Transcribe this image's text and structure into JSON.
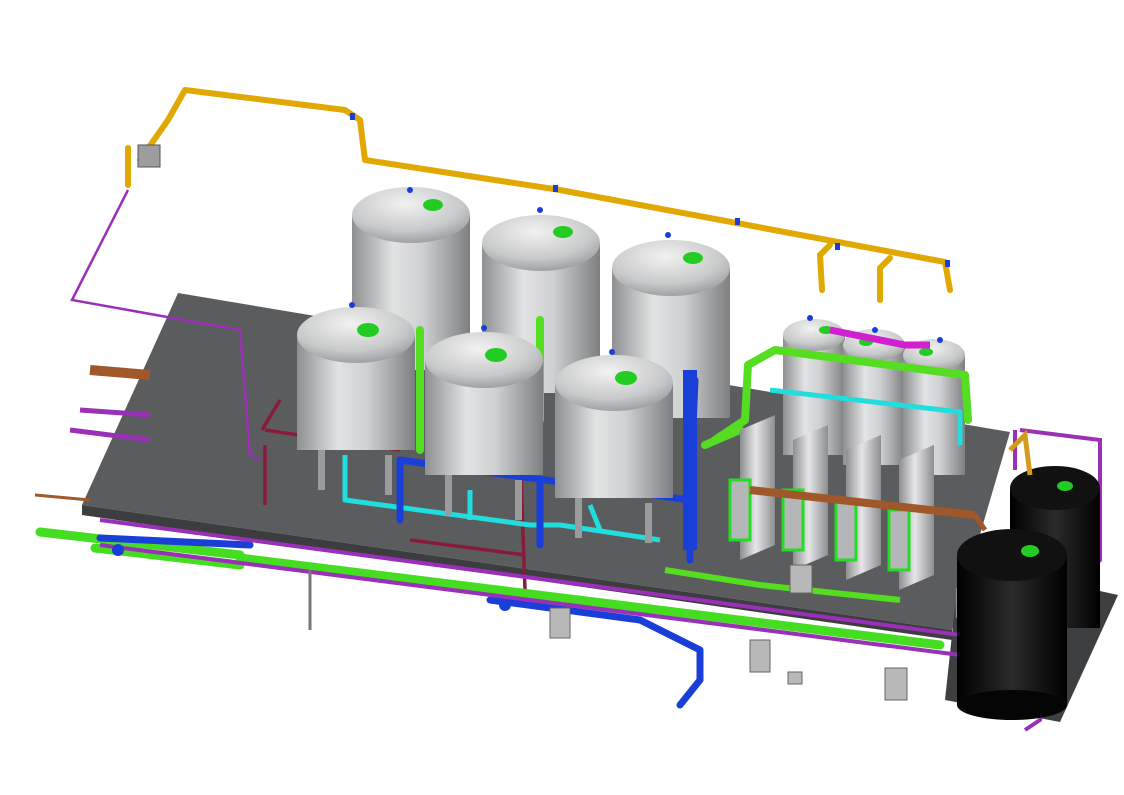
{
  "scene": {
    "kind": "3D piping and vessel layout rendering",
    "background": "#ffffff"
  },
  "colors": {
    "skid": "#58595b",
    "skid_top": "#666769",
    "vessel": "#c9cacb",
    "vessel_dark": "#8f9091",
    "nozzle_cap": "#22cc22",
    "air_line": "#e0a800",
    "green_line": "#55dd22",
    "cyan_line": "#22dddd",
    "blue_line": "#1a3fd8",
    "purple_line": "#9a2fb8",
    "maroon_line": "#8a1a3a",
    "copper_line": "#a0582a",
    "magenta_line": "#d020d0",
    "tank_black": "#0e0e0e",
    "panel_grey": "#b8b8b8"
  },
  "components": {
    "large_filter_vessels": 6,
    "small_vessels": 3,
    "membrane_modules": 4,
    "black_tanks": 2
  }
}
